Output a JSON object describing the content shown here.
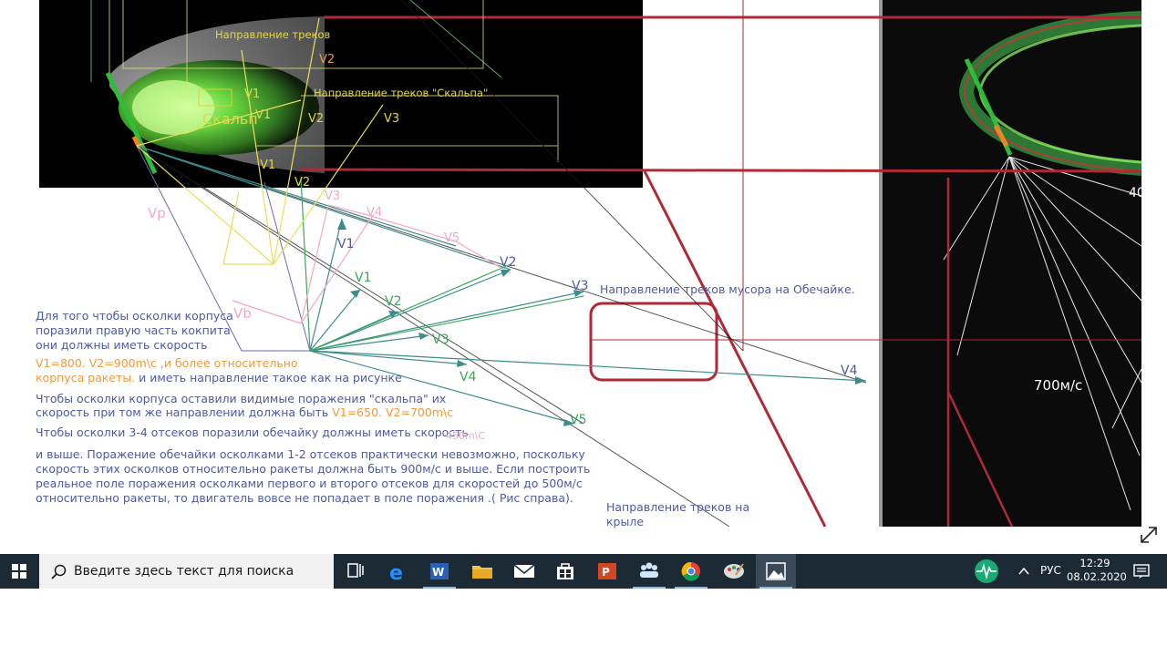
{
  "canvas": {
    "labels": {
      "track_direction": "Направление треков",
      "scalp_track_direction": "Направление треков \"Скальпа\"",
      "scalp": "Скальп",
      "v1": "V1",
      "v2": "V2",
      "v3": "V3",
      "v4": "V4",
      "v5": "V5",
      "vp": "Vp",
      "vb": "Vb",
      "shell_debris_direction": "Направление треков мусора на Обечайке.",
      "wing_direction_1": "Направление треков на",
      "wing_direction_2": "крыле",
      "right_value_1": "40",
      "right_value_2": "700м/с"
    },
    "notes": {
      "p1_line1": "Для того чтобы осколки корпуса",
      "p1_line2": "поразили правую часть кокпита",
      "p1_line3": "они должны иметь скорость",
      "p1_line4_orange": "V1=800. V2=900m\\c  ,и более относительно",
      "p1_line5_orange": "корпуса ракеты.",
      "p1_line5_rest": " и иметь направление такое как на рисунке",
      "p2_line1": "Чтобы осколки корпуса оставили видимые поражения \"скальпа\" их",
      "p2_line2": "скорость при том же направлении должна быть ",
      "p2_line2_orange": "V1=650. V2=700m\\c",
      "p3_line1": "Чтобы осколки 3-4 отсеков поразили обечайку должны иметь скорость",
      "p3_pink": "450m\\C",
      "p4_line1": "и выше. Поражение обечайки осколками 1-2 отсеков практически невозможно, поскольку",
      "p4_line2": "скорость этих осколков относительно ракеты должна быть 900м/с и выше. Если построить",
      "p4_line3": "реальное поле поражения осколками первого и второго отсеков для скоростей до 500м/с",
      "p4_line4": "относительно ракеты, то двигатель вовсе не попадает в поле поражения .( Рис справа)."
    }
  },
  "taskbar": {
    "search_placeholder": "Введите здесь текст для поиска",
    "language": "РУС",
    "time": "12:29",
    "date": "08.02.2020"
  },
  "colors": {
    "taskbar": "#1c2a36",
    "note_text": "#4e5aa3",
    "accent_orange": "#f09a3a",
    "red_line": "#b02a36",
    "teal_line": "#3d8c8c"
  }
}
